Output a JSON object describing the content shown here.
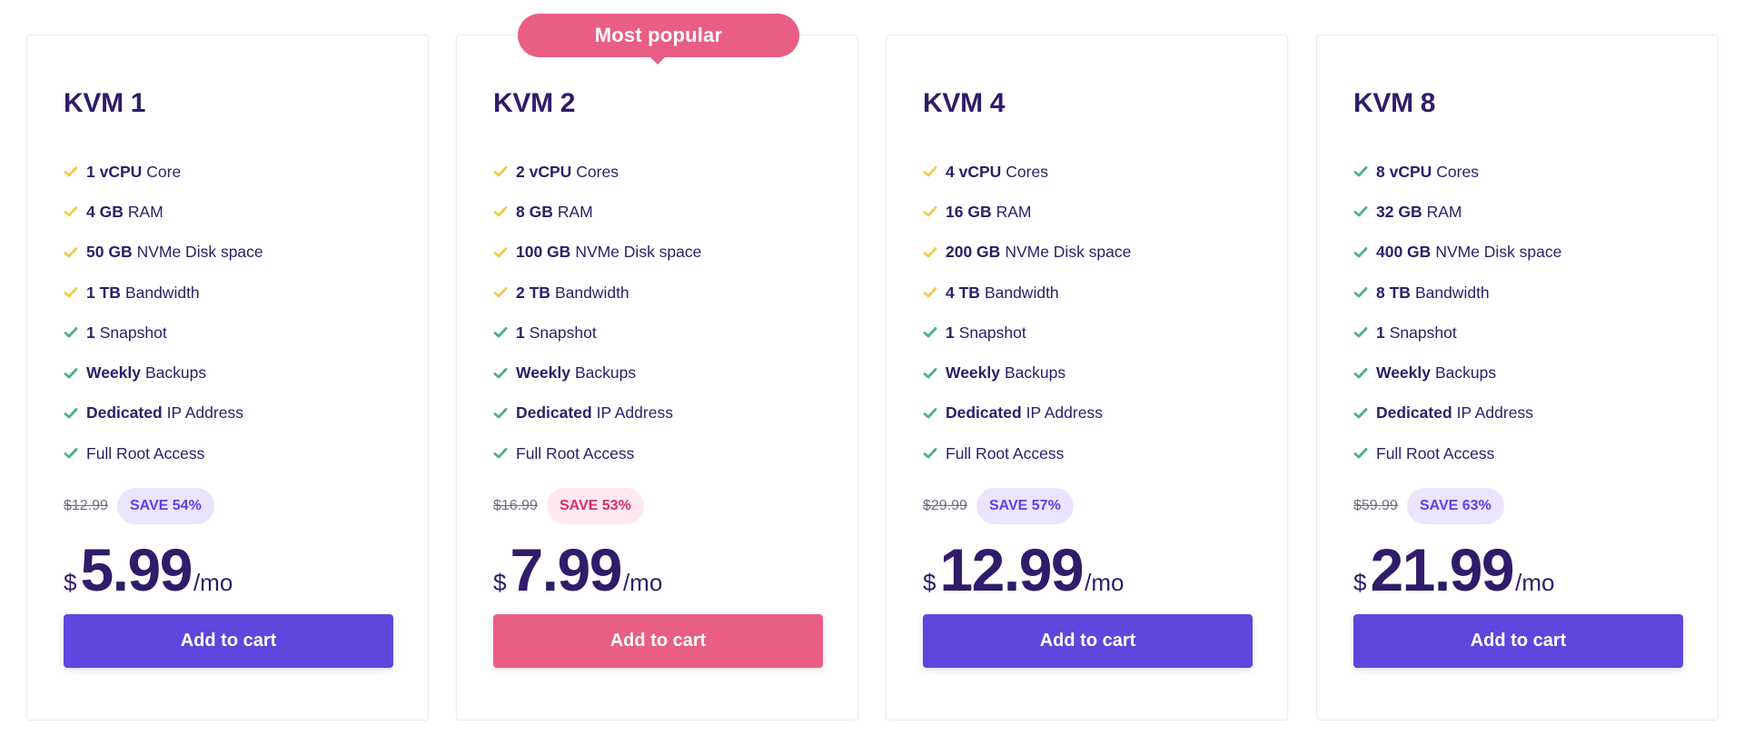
{
  "colors": {
    "primary": "#5d47dc",
    "accent_pink": "#e95e84",
    "heading": "#2f1c6a",
    "check_yellow": "#f2c94c",
    "check_green": "#4cae8a"
  },
  "plans": [
    {
      "name": "KVM 1",
      "features": [
        {
          "bold": "1 vCPU",
          "text": "Core",
          "check": "yellow"
        },
        {
          "bold": "4 GB",
          "text": "RAM",
          "check": "yellow"
        },
        {
          "bold": "50 GB",
          "text": "NVMe Disk space",
          "check": "yellow"
        },
        {
          "bold": "1 TB",
          "text": "Bandwidth",
          "check": "yellow"
        },
        {
          "bold": "1",
          "text": "Snapshot",
          "check": "green"
        },
        {
          "bold": "Weekly",
          "text": "Backups",
          "check": "green"
        },
        {
          "bold": "Dedicated",
          "text": "IP Address",
          "check": "green"
        },
        {
          "bold": "",
          "text": "Full Root Access",
          "check": "green"
        }
      ],
      "old_price": "$12.99",
      "save_label": "SAVE 54%",
      "currency": "$",
      "price": "5.99",
      "period": "/mo",
      "button_label": "Add to cart"
    },
    {
      "name": "KVM 2",
      "badge": "Most popular",
      "features": [
        {
          "bold": "2 vCPU",
          "text": "Cores",
          "check": "yellow"
        },
        {
          "bold": "8 GB",
          "text": "RAM",
          "check": "yellow"
        },
        {
          "bold": "100 GB",
          "text": "NVMe Disk space",
          "check": "yellow"
        },
        {
          "bold": "2 TB",
          "text": "Bandwidth",
          "check": "yellow"
        },
        {
          "bold": "1",
          "text": "Snapshot",
          "check": "green"
        },
        {
          "bold": "Weekly",
          "text": "Backups",
          "check": "green"
        },
        {
          "bold": "Dedicated",
          "text": "IP Address",
          "check": "green"
        },
        {
          "bold": "",
          "text": "Full Root Access",
          "check": "green"
        }
      ],
      "old_price": "$16.99",
      "save_label": "SAVE 53%",
      "currency": "$",
      "price": "7.99",
      "period": "/mo",
      "button_label": "Add to cart"
    },
    {
      "name": "KVM 4",
      "features": [
        {
          "bold": "4 vCPU",
          "text": "Cores",
          "check": "yellow"
        },
        {
          "bold": "16 GB",
          "text": "RAM",
          "check": "yellow"
        },
        {
          "bold": "200 GB",
          "text": "NVMe Disk space",
          "check": "yellow"
        },
        {
          "bold": "4 TB",
          "text": "Bandwidth",
          "check": "yellow"
        },
        {
          "bold": "1",
          "text": "Snapshot",
          "check": "green"
        },
        {
          "bold": "Weekly",
          "text": "Backups",
          "check": "green"
        },
        {
          "bold": "Dedicated",
          "text": "IP Address",
          "check": "green"
        },
        {
          "bold": "",
          "text": "Full Root Access",
          "check": "green"
        }
      ],
      "old_price": "$29.99",
      "save_label": "SAVE 57%",
      "currency": "$",
      "price": "12.99",
      "period": "/mo",
      "button_label": "Add to cart"
    },
    {
      "name": "KVM 8",
      "features": [
        {
          "bold": "8 vCPU",
          "text": "Cores",
          "check": "green"
        },
        {
          "bold": "32 GB",
          "text": "RAM",
          "check": "green"
        },
        {
          "bold": "400 GB",
          "text": "NVMe Disk space",
          "check": "green"
        },
        {
          "bold": "8 TB",
          "text": "Bandwidth",
          "check": "green"
        },
        {
          "bold": "1",
          "text": "Snapshot",
          "check": "green"
        },
        {
          "bold": "Weekly",
          "text": "Backups",
          "check": "green"
        },
        {
          "bold": "Dedicated",
          "text": "IP Address",
          "check": "green"
        },
        {
          "bold": "",
          "text": "Full Root Access",
          "check": "green"
        }
      ],
      "old_price": "$59.99",
      "save_label": "SAVE 63%",
      "currency": "$",
      "price": "21.99",
      "period": "/mo",
      "button_label": "Add to cart"
    }
  ]
}
